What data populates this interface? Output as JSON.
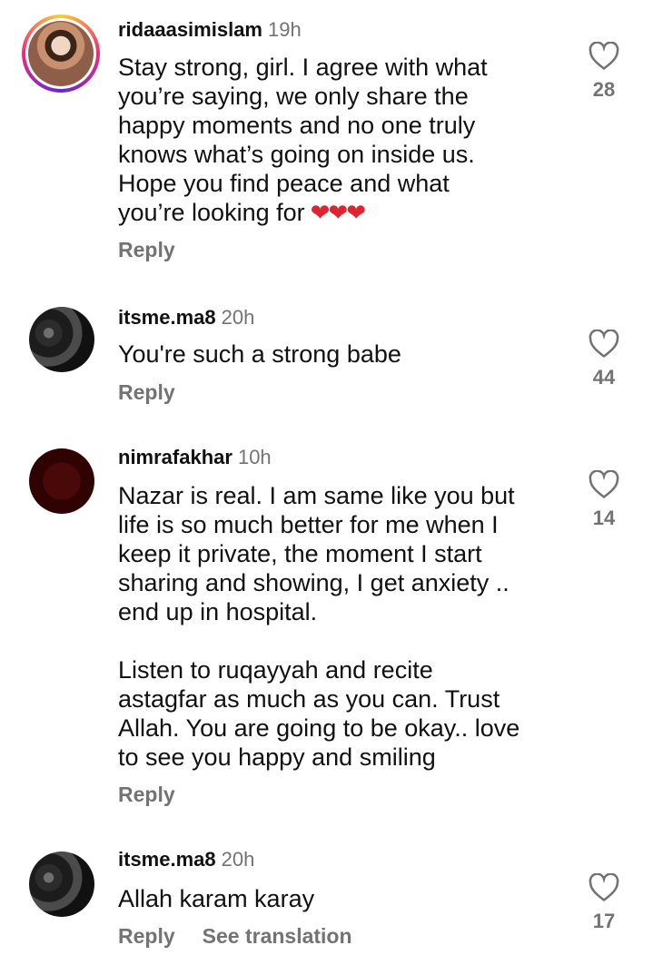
{
  "comments": [
    {
      "username": "ridaaasimislam",
      "time": "19h",
      "text": "Stay strong, girl. I agree with what\nyou’re saying, we only share the\nhappy moments and no one truly\nknows what’s going on inside us.\nHope you find peace and what\nyou’re looking for",
      "emoji": "❤❤❤",
      "reply_label": "Reply",
      "likes": "28",
      "avatar_icon": "profile-photo-with-story-ring"
    },
    {
      "username": "itsme.ma8",
      "time": "20h",
      "text": "You're such a strong babe",
      "reply_label": "Reply",
      "likes": "44",
      "avatar_icon": "profile-photo"
    },
    {
      "username": "nimrafakhar",
      "time": "10h",
      "text": "Nazar is real. I am same like you but\nlife is so much better for me when I\nkeep it private, the moment I start\nsharing and showing, I get anxiety ..\nend up in hospital.\n\nListen to ruqayyah and recite\nastagfar as much as you can. Trust\nAllah. You are going to be okay.. love\nto see you happy and smiling",
      "reply_label": "Reply",
      "likes": "14",
      "avatar_icon": "profile-photo"
    },
    {
      "username": "itsme.ma8",
      "time": "20h",
      "text": "Allah karam karay",
      "reply_label": "Reply",
      "see_translation_label": "See translation",
      "likes": "17",
      "avatar_icon": "profile-photo"
    }
  ],
  "colors": {
    "heart_emoji": "#e0242f",
    "secondary_text": "#737373",
    "story_ring": [
      "#f9ce34",
      "#ee2a7b",
      "#6228d7"
    ]
  }
}
